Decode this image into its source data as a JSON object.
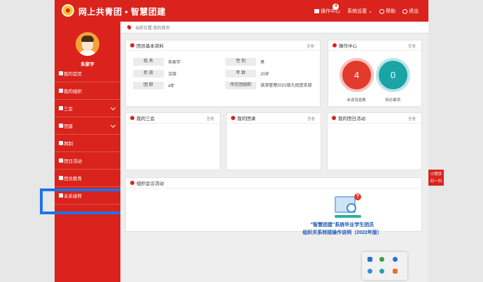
{
  "header": {
    "brand": "网上共青团 • 智慧团建",
    "notifications_label": "操作中心",
    "notifications_count": "4",
    "settings_label": "系统设置",
    "help_label": "帮助",
    "logout_label": "退出"
  },
  "breadcrumb": {
    "text": "当前位置:我的首页"
  },
  "user": {
    "name": "朱家宇"
  },
  "sidebar": {
    "items": [
      {
        "label": "我的首页",
        "icon": "home-icon"
      },
      {
        "label": "我的组织",
        "icon": "org-icon"
      },
      {
        "label": "三会",
        "icon": "check-icon"
      },
      {
        "label": "团建",
        "icon": "folder-icon"
      },
      {
        "label": "两制",
        "icon": "target-icon"
      },
      {
        "label": "团日活动",
        "icon": "gear-icon"
      },
      {
        "label": "团员教育",
        "icon": "graduation-icon"
      },
      {
        "label": "关系接转",
        "icon": "refresh-icon"
      }
    ]
  },
  "profile_panel": {
    "title": "团员基本资料",
    "more": "查看",
    "rows": [
      {
        "l1": "姓 名",
        "v1": "朱家宇",
        "l2": "性 别",
        "v2": "男"
      },
      {
        "l1": "民 族",
        "v1": "汉族",
        "l2": "年 龄",
        "v2": "20岁"
      },
      {
        "l1": "团 龄",
        "v1": "4年",
        "l2": "所在团组织",
        "v2": "旅游管理2021级九班团支部"
      }
    ]
  },
  "ops_panel": {
    "title": "操作中心",
    "more": "查看",
    "unread_count": "4",
    "unread_label": "未读消息数",
    "todo_count": "0",
    "todo_label": "待办事项"
  },
  "panels": [
    {
      "title": "我的三会",
      "more": "查看"
    },
    {
      "title": "我的团课",
      "more": "查看"
    },
    {
      "title": "我的团日活动",
      "more": "查看"
    }
  ],
  "meeting_panel": {
    "title": "组织会议活动",
    "promo_line1": "\"智慧团建\"系统毕业学生团员",
    "promo_line2": "组织关系转接操作说明（2022年版）"
  },
  "qr_tab": {
    "line1": "小程序",
    "line2": "扫一扫"
  },
  "colors": {
    "primary": "#d9231c",
    "teal": "#1ba4a6",
    "highlight": "#1e73e8",
    "link_blue": "#1b58b7"
  }
}
